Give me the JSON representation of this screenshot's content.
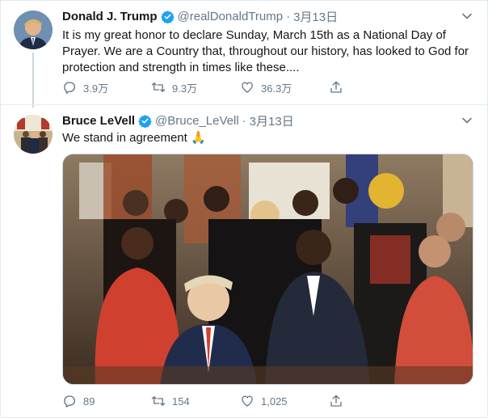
{
  "tweets": [
    {
      "name": "Donald J. Trump",
      "handle": "@realDonaldTrump",
      "separator": "·",
      "date": "3月13日",
      "text": "It is my great honor to declare Sunday, March 15th as a National Day of Prayer. We are a Country that, throughout our history, has looked to God for protection and strength in times like these....",
      "replies": "3.9万",
      "retweets": "9.3万",
      "likes": "36.3万"
    },
    {
      "name": "Bruce LeVell",
      "handle": "@Bruce_LeVell",
      "separator": "·",
      "date": "3月13日",
      "text": "We stand in agreement 🙏",
      "replies": "89",
      "retweets": "154",
      "likes": "1,025"
    }
  ],
  "colors": {
    "verified": "#1da1f2",
    "muted": "#657786",
    "border": "#e1e8ed",
    "thread_line": "#ccd6dd"
  },
  "icons": [
    "verified-badge-icon",
    "chevron-down-icon",
    "reply-icon",
    "retweet-icon",
    "like-icon",
    "share-icon"
  ]
}
